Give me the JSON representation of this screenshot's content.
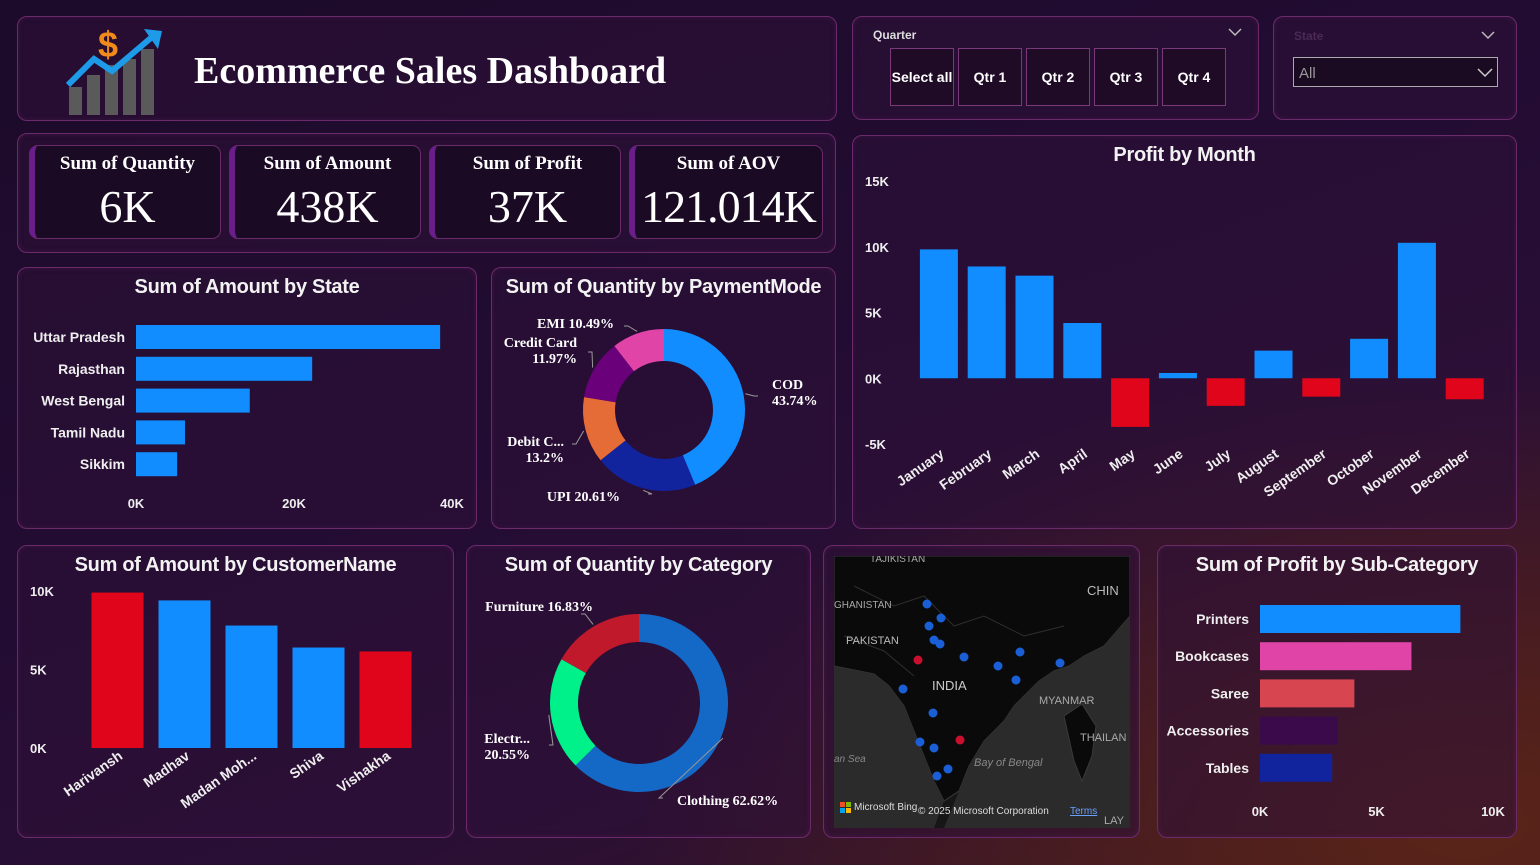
{
  "header": {
    "title": "Ecommerce Sales Dashboard",
    "logo_icon": "sales-growth-chart-icon"
  },
  "slicers": {
    "quarter": {
      "label": "Quarter",
      "options": [
        "Select all",
        "Qtr 1",
        "Qtr 2",
        "Qtr 3",
        "Qtr 4"
      ]
    },
    "state": {
      "label": "State",
      "value": "All"
    }
  },
  "kpis": [
    {
      "label": "Sum of Quantity",
      "value": "6K"
    },
    {
      "label": "Sum of Amount",
      "value": "438K"
    },
    {
      "label": "Sum of Profit",
      "value": "37K"
    },
    {
      "label": "Sum of AOV",
      "value": "121.014K"
    }
  ],
  "colors": {
    "blue": "#118dff",
    "red": "#e0051a",
    "pink": "#e044a7",
    "purple": "#6b007b",
    "orange": "#e66c37",
    "navy": "#12239e",
    "green": "#1aab40"
  },
  "map": {
    "labels": [
      "TAJIKISTAN",
      "GHANISTAN",
      "PAKISTAN",
      "INDIA",
      "MYANMAR",
      "THAILAN",
      "CHIN",
      "Bay of Bengal",
      "an Sea",
      "LAY"
    ],
    "attribution": "© 2025 Microsoft Corporation",
    "terms": "Terms",
    "bing": "Microsoft Bing"
  },
  "chart_data": [
    {
      "id": "amount-by-state",
      "type": "bar",
      "orientation": "horizontal",
      "title": "Sum of Amount by State",
      "categories": [
        "Uttar Pradesh",
        "Rajasthan",
        "West Bengal",
        "Tamil Nadu",
        "Sikkim"
      ],
      "values": [
        38500,
        22300,
        14400,
        6200,
        5200
      ],
      "xlim": [
        0,
        40000
      ],
      "ticks": [
        "0K",
        "20K",
        "40K"
      ],
      "ticks_values": [
        0,
        20000,
        40000
      ]
    },
    {
      "id": "quantity-by-paymentmode",
      "type": "pie",
      "donut": true,
      "title": "Sum of Quantity by PaymentMode",
      "slices": [
        {
          "label": "COD",
          "pct": "43.74%",
          "value": 43.74,
          "color": "#118dff"
        },
        {
          "label": "UPI",
          "pct": "20.61%",
          "value": 20.61,
          "color": "#12239e"
        },
        {
          "label": "Debit C...",
          "pct": "13.2%",
          "value": 13.2,
          "color": "#e66c37"
        },
        {
          "label": "Credit Card",
          "pct": "11.97%",
          "value": 11.97,
          "color": "#6b007b"
        },
        {
          "label": "EMI",
          "pct": "10.49%",
          "value": 10.49,
          "color": "#e044a7"
        }
      ]
    },
    {
      "id": "profit-by-month",
      "type": "bar",
      "title": "Profit by Month",
      "categories": [
        "January",
        "February",
        "March",
        "April",
        "May",
        "June",
        "July",
        "August",
        "September",
        "October",
        "November",
        "December"
      ],
      "values": [
        9800,
        8500,
        7800,
        4200,
        -3700,
        400,
        -2100,
        2100,
        -1400,
        3000,
        10300,
        -1600
      ],
      "ylim": [
        -5000,
        15000
      ],
      "ticks": [
        "15K",
        "10K",
        "5K",
        "0K",
        "-5K"
      ],
      "ticks_values": [
        15000,
        10000,
        5000,
        0,
        -5000
      ]
    },
    {
      "id": "amount-by-customer",
      "type": "bar",
      "title": "Sum of Amount by CustomerName",
      "categories": [
        "Harivansh",
        "Madhav",
        "Madan Moh...",
        "Shiva",
        "Vishakha"
      ],
      "values": [
        9900,
        9400,
        7800,
        6400,
        6150
      ],
      "bar_colors": [
        "#e0051a",
        "#118dff",
        "#118dff",
        "#118dff",
        "#e0051a"
      ],
      "ylim": [
        0,
        10000
      ],
      "ticks": [
        "10K",
        "5K",
        "0K"
      ],
      "ticks_values": [
        10000,
        5000,
        0
      ]
    },
    {
      "id": "quantity-by-category",
      "type": "pie",
      "donut": true,
      "title": "Sum of Quantity by Category",
      "slices": [
        {
          "label": "Clothing",
          "pct": "62.62%",
          "value": 62.62,
          "color": "#1468c6"
        },
        {
          "label": "Electr...",
          "pct": "20.55%",
          "value": 20.55,
          "color": "#00f08a"
        },
        {
          "label": "Furniture",
          "pct": "16.83%",
          "value": 16.83,
          "color": "#c0192c"
        }
      ]
    },
    {
      "id": "profit-by-subcategory",
      "type": "bar",
      "orientation": "horizontal",
      "title": "Sum of Profit by Sub-Category",
      "categories": [
        "Printers",
        "Bookcases",
        "Saree",
        "Accessories",
        "Tables"
      ],
      "values": [
        8600,
        6500,
        4050,
        3350,
        3100
      ],
      "bar_colors": [
        "#118dff",
        "#e044a7",
        "#d64550",
        "#3a0a4a",
        "#12239e"
      ],
      "xlim": [
        0,
        10000
      ],
      "ticks": [
        "0K",
        "5K",
        "10K"
      ],
      "ticks_values": [
        0,
        5000,
        10000
      ]
    }
  ]
}
